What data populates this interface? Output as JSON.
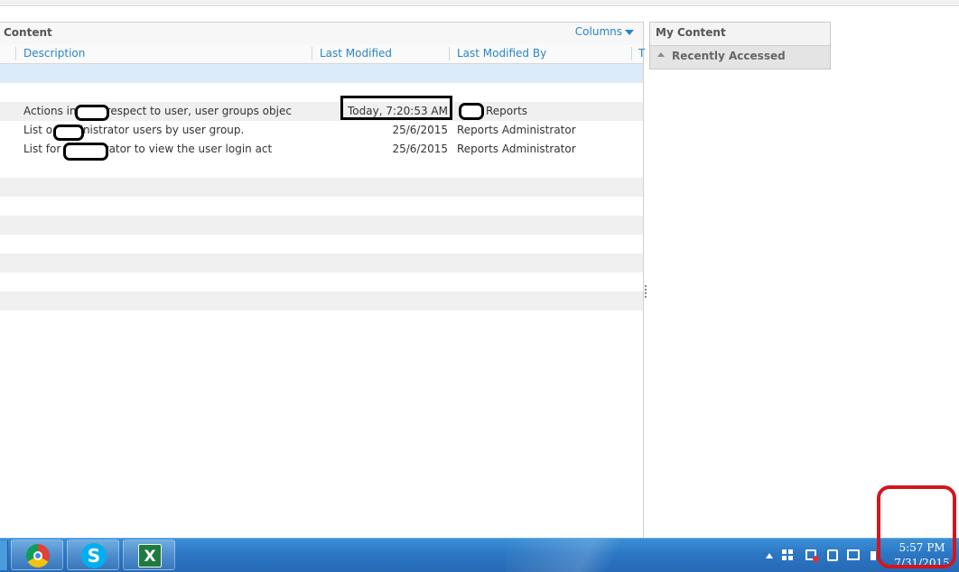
{
  "content": {
    "title": "Content",
    "columns_label": "Columns",
    "headers": {
      "description": "Description",
      "last_modified": "Last Modified",
      "last_modified_by": "Last Modified By",
      "truncated": "T"
    },
    "rows": [
      {
        "description": "Actions in        with respect to user, user groups objec",
        "last_modified": "Today, 7:20:53 AM",
        "last_modified_by": "Reports"
      },
      {
        "description": "List o        administrator users by user group.",
        "last_modified": "25/6/2015",
        "last_modified_by": "Reports Administrator"
      },
      {
        "description": "List for            dministrator to view the user login act",
        "last_modified": "25/6/2015",
        "last_modified_by": "Reports Administrator"
      }
    ]
  },
  "my_content": {
    "title": "My Content",
    "recently_accessed": "Recently Accessed"
  },
  "taskbar": {
    "apps": [
      {
        "name": "chrome",
        "icon": "chrome-icon"
      },
      {
        "name": "skype",
        "icon": "skype-icon",
        "glyph": "S"
      },
      {
        "name": "excel",
        "icon": "excel-icon",
        "glyph": "X"
      }
    ],
    "clock": {
      "time": "5:57 PM",
      "date": "7/31/2015"
    }
  },
  "colors": {
    "link": "#2a84c9",
    "taskbar": "#2c77c4",
    "annotation_red": "#d4151f",
    "selected_row": "#dcebfa"
  }
}
